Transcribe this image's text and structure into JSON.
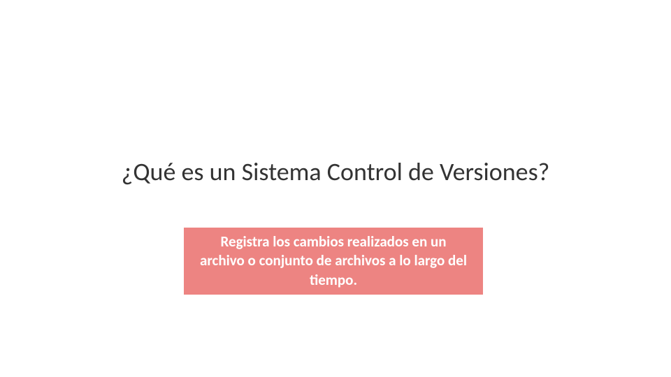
{
  "title": "¿Qué es un Sistema Control de Versiones?",
  "box_text": "Registra los cambios realizados en un archivo o conjunto de archivos a lo largo del tiempo.",
  "colors": {
    "accent": "#ed8482",
    "text": "#333333",
    "box_text": "#ffffff"
  }
}
